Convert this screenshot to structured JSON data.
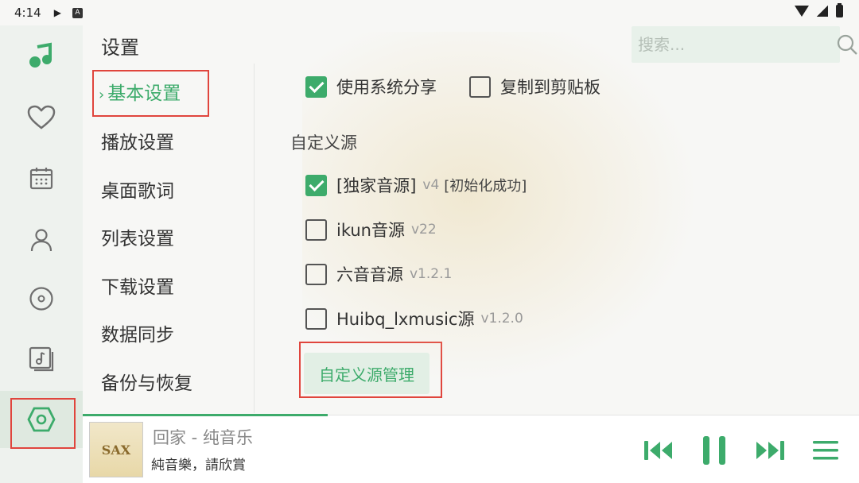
{
  "status_bar": {
    "time": "4:14"
  },
  "header": {
    "title": "设置"
  },
  "search": {
    "placeholder": "搜索..."
  },
  "settings_nav": {
    "items": [
      {
        "label": "基本设置",
        "active": true
      },
      {
        "label": "播放设置"
      },
      {
        "label": "桌面歌词"
      },
      {
        "label": "列表设置"
      },
      {
        "label": "下载设置"
      },
      {
        "label": "数据同步"
      },
      {
        "label": "备份与恢复"
      }
    ]
  },
  "content": {
    "share_option": {
      "label": "使用系统分享",
      "checked": true
    },
    "clipboard_option": {
      "label": "复制到剪贴板",
      "checked": false
    },
    "custom_source_label": "自定义源",
    "sources": [
      {
        "name": "[独家音源]",
        "version": "v4",
        "status": "[初始化成功]",
        "checked": true
      },
      {
        "name": "ikun音源",
        "version": "v22",
        "checked": false
      },
      {
        "name": "六音音源",
        "version": "v1.2.1",
        "checked": false
      },
      {
        "name": "Huibq_lxmusic源",
        "version": "v1.2.0",
        "checked": false
      }
    ],
    "manage_button": "自定义源管理"
  },
  "player": {
    "title": "回家 - 纯音乐",
    "subtitle": "純音樂，請欣賞",
    "cover_text": "SAX",
    "progress": 0.316
  },
  "colors": {
    "accent": "#3dab6b",
    "highlight_box": "#e0453d"
  }
}
